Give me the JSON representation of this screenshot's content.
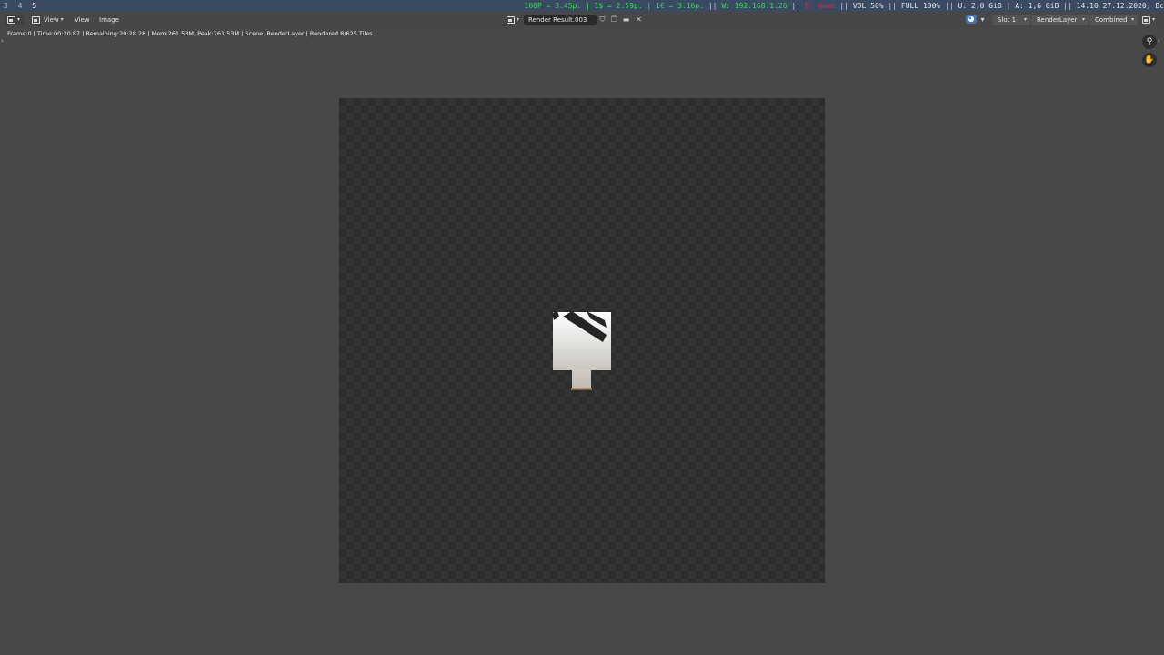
{
  "sysbar": {
    "workspaces": [
      "3",
      "4",
      "5"
    ],
    "active_workspace": "5",
    "status": {
      "rates": "100P = 3.45p. | 1$ = 2.59p. | 1€ = 3.16p.",
      "network": "W: 192.168.1.26",
      "ethernet_down": "E: down",
      "volume": "VOL 50%",
      "battery": "FULL 100%",
      "disk_u": "U: 2,0 GiB",
      "disk_a": "A: 1,6 GiB",
      "datetime": "14:10 27.12.2020, Bc"
    },
    "colors": {
      "good": "#2ee24a",
      "bad": "#e02a2a"
    }
  },
  "header": {
    "editor_icon": "image-editor-icon",
    "mode_label": "View",
    "menu_view": "View",
    "menu_image": "Image",
    "image_name": "Render Result.003",
    "slot": "Slot 1",
    "layer": "RenderLayer",
    "pass": "Combined"
  },
  "info_line": "Frame:0 | Time:00:20.87 | Remaining:20:28.28 | Mem:261.53M, Peak:261.53M | Scene, RenderLayer | Rendered 8/625 Tiles",
  "gizmos": {
    "zoom_icon": "zoom-icon",
    "pan_icon": "hand-pan-icon"
  },
  "render": {
    "tiles_rendered": 8,
    "tiles_total": 625
  }
}
